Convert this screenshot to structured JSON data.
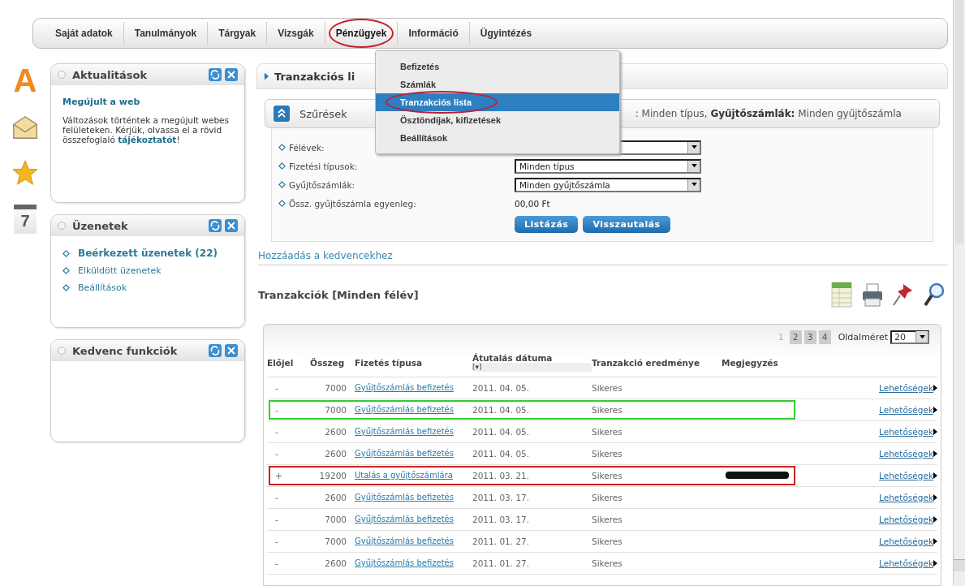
{
  "nav": [
    {
      "label": "Saját adatok",
      "selected": false,
      "circled": false
    },
    {
      "label": "Tanulmányok",
      "selected": false,
      "circled": false
    },
    {
      "label": "Tárgyak",
      "selected": false,
      "circled": false
    },
    {
      "label": "Vizsgák",
      "selected": false,
      "circled": false
    },
    {
      "label": "Pénzügyek",
      "selected": true,
      "circled": true
    },
    {
      "label": "Információ",
      "selected": false,
      "circled": false
    },
    {
      "label": "Ügyintézés",
      "selected": false,
      "circled": false
    }
  ],
  "menu": [
    {
      "label": "Befizetés",
      "selected": false,
      "circled": false
    },
    {
      "label": "Számlák",
      "selected": false,
      "circled": false
    },
    {
      "label": "Tranzakciós lista",
      "selected": true,
      "circled": true
    },
    {
      "label": "Ösztöndíjak, kifizetések",
      "selected": false,
      "circled": false
    },
    {
      "label": "Beállítások",
      "selected": false,
      "circled": false
    }
  ],
  "side_icons": [
    {
      "kind": "letter",
      "text": "A"
    },
    {
      "kind": "envelope"
    },
    {
      "kind": "star"
    },
    {
      "kind": "calendar",
      "text": "7"
    }
  ],
  "panels": [
    {
      "title": "Aktualitások",
      "kind": "news",
      "heading": "Megújult a web",
      "text": "Változások történtek a megújult webes felületeken. Kérjük, olvassa el a rövid összefoglaló **tájékoztatót**!"
    },
    {
      "title": "Üzenetek",
      "kind": "links",
      "links": [
        {
          "label": "Beérkezett üzenetek (22)",
          "bold": true
        },
        {
          "label": "Elküldött üzenetek",
          "bold": false
        },
        {
          "label": "Beállítások",
          "bold": false
        }
      ]
    },
    {
      "title": "Kedvenc funkciók",
      "kind": "empty"
    }
  ],
  "page_title": "Tranzakciós li",
  "filter": {
    "title": "Szűrések",
    "summary": ": Minden típus, **Gyűjtőszámlák:** Minden gyűjtőszámla",
    "fields": [
      {
        "label": "Félévek:",
        "kind": "select"
      },
      {
        "label": "Fizetési típusok:",
        "kind": "select",
        "value": "Minden típus"
      },
      {
        "label": "Gyűjtőszámlák:",
        "kind": "select",
        "value": "Minden gyűjtőszámla"
      },
      {
        "label": "Össz. gyűjtőszámla egyenleg:",
        "kind": "text",
        "value": "00,00 Ft"
      }
    ],
    "buttons": [
      "Listázás",
      "Visszautalás"
    ]
  },
  "favorite_link": "Hozzáadás a kedvencekhez",
  "section_title": "Tranzakciók [Minden félév]",
  "pager": {
    "pages": [
      {
        "label": "1",
        "selected": true
      },
      {
        "label": "2",
        "selected": false
      },
      {
        "label": "3",
        "selected": false
      },
      {
        "label": "4",
        "selected": false
      }
    ],
    "page_size_label": "Oldalméret",
    "page_size": "20"
  },
  "table": {
    "columns": [
      "Előjel",
      "Összeg",
      "Fizetés típusa",
      "Átutalás dátuma",
      "Tranzakció eredménye",
      "Megjegyzés"
    ],
    "sort_mark": "[▾]",
    "rows": [
      {
        "sign": "-",
        "amount": "7000",
        "type": "Gyűjtőszámlás befizetés",
        "date": "2011. 04. 05.",
        "result": "Sikeres",
        "action": "Lehetőségek"
      },
      {
        "sign": "-",
        "amount": "7000",
        "type": "Gyűjtőszámlás befizetés",
        "date": "2011. 04. 05.",
        "result": "Sikeres",
        "action": "Lehetőségek",
        "color": "#33cc33"
      },
      {
        "sign": "-",
        "amount": "2600",
        "type": "Gyűjtőszámlás befizetés",
        "date": "2011. 04. 05.",
        "result": "Sikeres",
        "action": "Lehetőségek"
      },
      {
        "sign": "-",
        "amount": "2600",
        "type": "Gyűjtőszámlás befizetés",
        "date": "2011. 04. 05.",
        "result": "Sikeres",
        "action": "Lehetőségek"
      },
      {
        "sign": "+",
        "amount": "19200",
        "type": "Utalás a gyűjtőszámlára",
        "date": "2011. 03. 21.",
        "result": "Sikeres",
        "action": "Lehetőségek",
        "color": "#cc2222",
        "redacted": true
      },
      {
        "sign": "-",
        "amount": "2600",
        "type": "Gyűjtőszámlás befizetés",
        "date": "2011. 03. 17.",
        "result": "Sikeres",
        "action": "Lehetőségek"
      },
      {
        "sign": "-",
        "amount": "7000",
        "type": "Gyűjtőszámlás befizetés",
        "date": "2011. 03. 17.",
        "result": "Sikeres",
        "action": "Lehetőségek"
      },
      {
        "sign": "-",
        "amount": "7000",
        "type": "Gyűjtőszámlás befizetés",
        "date": "2011. 01. 27.",
        "result": "Sikeres",
        "action": "Lehetőségek"
      },
      {
        "sign": "-",
        "amount": "2600",
        "type": "Gyűjtőszámlás befizetés",
        "date": "2011. 01. 27.",
        "result": "Sikeres",
        "action": "Lehetőségek"
      }
    ]
  }
}
